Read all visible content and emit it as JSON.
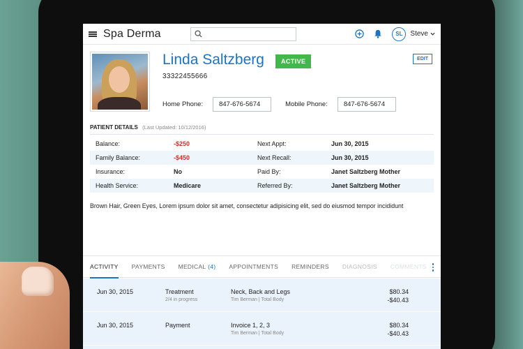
{
  "app": {
    "title": "Spa Derma",
    "search_placeholder": "",
    "user_initials": "SL",
    "user_name": "Steve"
  },
  "patient": {
    "name": "Linda Saltzberg",
    "status": "ACTIVE",
    "id": "33322455666",
    "edit_label": "EDIT",
    "home_phone_label": "Home Phone:",
    "home_phone": "847-676-5674",
    "mobile_phone_label": "Mobile Phone:",
    "mobile_phone": "847-676-5674"
  },
  "details": {
    "heading": "PATIENT DETAILS",
    "last_updated": "(Last Updated: 10/12/2016)",
    "rows": [
      {
        "l1": "Balance:",
        "v1": "-$250",
        "l2": "Next Appt:",
        "v2": "Jun 30, 2015"
      },
      {
        "l1": "Family Balance:",
        "v1": "-$450",
        "l2": "Next Recall:",
        "v2": "Jun 30, 2015"
      },
      {
        "l1": "Insurance:",
        "v1": "No",
        "l2": "Paid By:",
        "v2": "Janet Saltzberg Mother"
      },
      {
        "l1": "Health Service:",
        "v1": "Medicare",
        "l2": "Referred By:",
        "v2": "Janet Saltzberg Mother"
      }
    ],
    "description": "Brown Hair, Green Eyes, Lorem ipsum dolor sit amet, consectetur adipisicing elit, sed do eiusmod tempor incididunt"
  },
  "tabs": {
    "activity": "ACTIVITY",
    "payments": "PAYMENTS",
    "medical": "MEDICAL",
    "medical_count": "(4)",
    "appointments": "APPOINTMENTS",
    "reminders": "REMINDERS",
    "diagnosis": "DIAGNOSIS",
    "comments": "COMMENTS"
  },
  "activity": [
    {
      "date": "Jun 30, 2015",
      "type": "Treatment",
      "sub": "2/4 in progress",
      "desc": "Neck, Back and Legs",
      "who": "Tim Berman | Total Body",
      "amount": "$80.34",
      "amount2": "-$40.43"
    },
    {
      "date": "Jun 30, 2015",
      "type": "Payment",
      "sub": "",
      "desc": "Invoice 1, 2, 3",
      "who": "Tim Berman | Total Body",
      "amount": "$80.34",
      "amount2": "-$40.43"
    }
  ],
  "colors": {
    "accent": "#1c72c4",
    "active_badge": "#42b84a",
    "negative": "#d0312d"
  }
}
